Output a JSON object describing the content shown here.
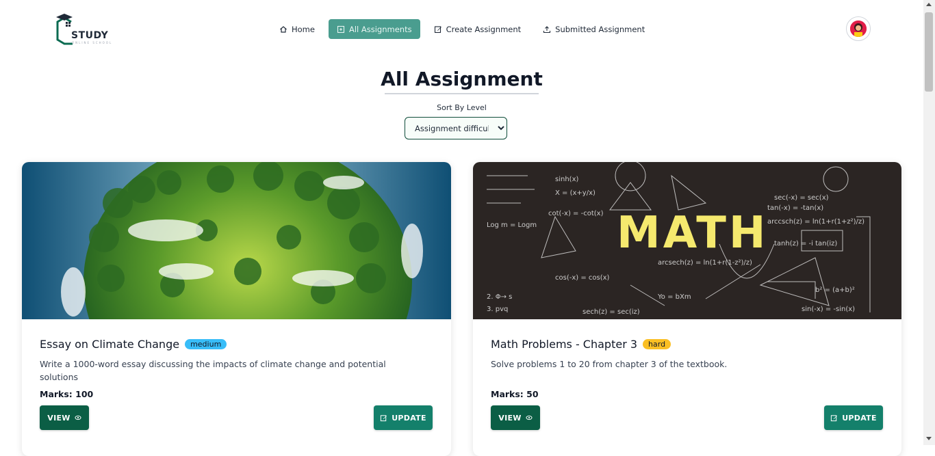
{
  "brand": {
    "name": "STUDY",
    "tagline": "ONLINE SCHOOL"
  },
  "nav": {
    "items": [
      {
        "label": "Home",
        "icon": "home-icon",
        "active": false
      },
      {
        "label": "All Assignments",
        "icon": "assignments-icon",
        "active": true
      },
      {
        "label": "Create Assignment",
        "icon": "edit-icon",
        "active": false
      },
      {
        "label": "Submitted Assignment",
        "icon": "upload-icon",
        "active": false
      }
    ]
  },
  "page": {
    "title": "All Assignment",
    "sort_label": "Sort By Level",
    "sort_value": "Assignment difficulty"
  },
  "cards": [
    {
      "title": "Essay on Climate Change",
      "level": "medium",
      "description": "Write a 1000-word essay discussing the impacts of climate change and potential solutions",
      "marks_label": "Marks: 100",
      "view_label": "VIEW",
      "update_label": "UPDATE",
      "image": "green-earth-forest"
    },
    {
      "title": "Math Problems - Chapter 3",
      "level": "hard",
      "description": "Solve problems 1 to 20 from chapter 3 of the textbook.",
      "marks_label": "Marks: 50",
      "view_label": "VIEW",
      "update_label": "UPDATE",
      "image": "math-chalkboard"
    }
  ],
  "colors": {
    "primary": "#0b5e45",
    "accent": "#4a9d8f",
    "medium_badge": "#38bdf8",
    "hard_badge": "#fbbf24"
  }
}
